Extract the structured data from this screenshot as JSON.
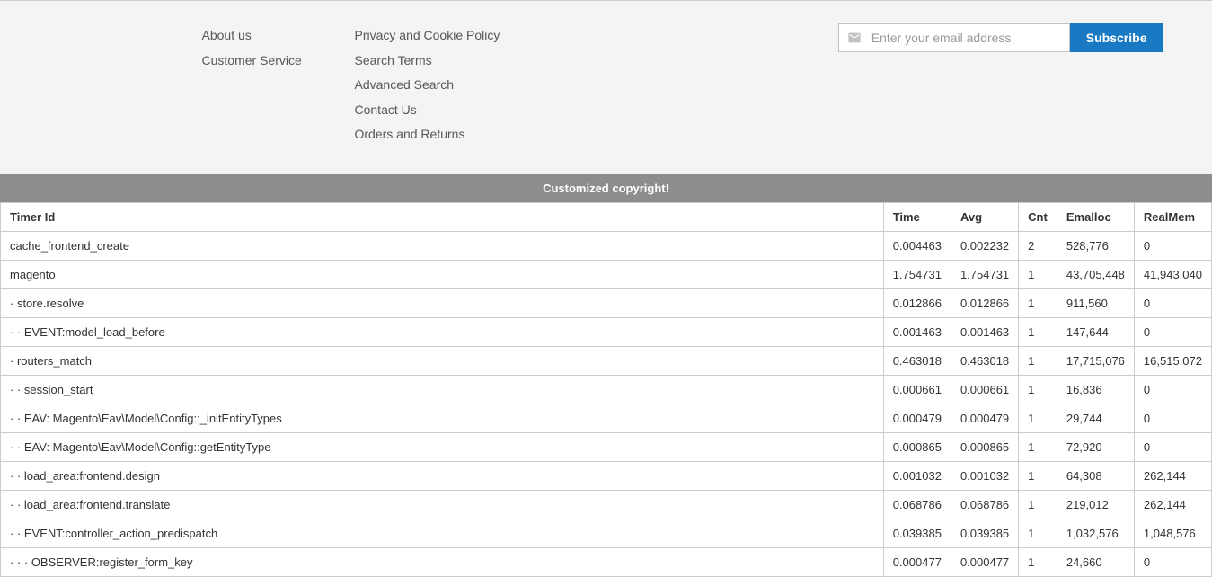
{
  "footer": {
    "col1": [
      {
        "label": "About us"
      },
      {
        "label": "Customer Service"
      }
    ],
    "col2": [
      {
        "label": "Privacy and Cookie Policy"
      },
      {
        "label": "Search Terms"
      },
      {
        "label": "Advanced Search"
      },
      {
        "label": "Contact Us"
      },
      {
        "label": "Orders and Returns"
      }
    ],
    "newsletter": {
      "placeholder": "Enter your email address",
      "subscribe_label": "Subscribe"
    }
  },
  "copyright": "Customized copyright!",
  "profiler": {
    "headers": [
      "Timer Id",
      "Time",
      "Avg",
      "Cnt",
      "Emalloc",
      "RealMem"
    ],
    "rows": [
      {
        "id": "cache_frontend_create",
        "time": "0.004463",
        "avg": "0.002232",
        "cnt": "2",
        "emalloc": "528,776",
        "realmem": "0"
      },
      {
        "id": "magento",
        "time": "1.754731",
        "avg": "1.754731",
        "cnt": "1",
        "emalloc": "43,705,448",
        "realmem": "41,943,040"
      },
      {
        "id": "·  store.resolve",
        "time": "0.012866",
        "avg": "0.012866",
        "cnt": "1",
        "emalloc": "911,560",
        "realmem": "0"
      },
      {
        "id": "·  ·  EVENT:model_load_before",
        "time": "0.001463",
        "avg": "0.001463",
        "cnt": "1",
        "emalloc": "147,644",
        "realmem": "0"
      },
      {
        "id": "·  routers_match",
        "time": "0.463018",
        "avg": "0.463018",
        "cnt": "1",
        "emalloc": "17,715,076",
        "realmem": "16,515,072"
      },
      {
        "id": "·  ·  session_start",
        "time": "0.000661",
        "avg": "0.000661",
        "cnt": "1",
        "emalloc": "16,836",
        "realmem": "0"
      },
      {
        "id": "·  ·  EAV: Magento\\Eav\\Model\\Config::_initEntityTypes",
        "time": "0.000479",
        "avg": "0.000479",
        "cnt": "1",
        "emalloc": "29,744",
        "realmem": "0"
      },
      {
        "id": "·  ·  EAV: Magento\\Eav\\Model\\Config::getEntityType",
        "time": "0.000865",
        "avg": "0.000865",
        "cnt": "1",
        "emalloc": "72,920",
        "realmem": "0"
      },
      {
        "id": "·  ·  load_area:frontend.design",
        "time": "0.001032",
        "avg": "0.001032",
        "cnt": "1",
        "emalloc": "64,308",
        "realmem": "262,144"
      },
      {
        "id": "·  ·  load_area:frontend.translate",
        "time": "0.068786",
        "avg": "0.068786",
        "cnt": "1",
        "emalloc": "219,012",
        "realmem": "262,144"
      },
      {
        "id": "·  ·  EVENT:controller_action_predispatch",
        "time": "0.039385",
        "avg": "0.039385",
        "cnt": "1",
        "emalloc": "1,032,576",
        "realmem": "1,048,576"
      },
      {
        "id": "·  ·  ·  OBSERVER:register_form_key",
        "time": "0.000477",
        "avg": "0.000477",
        "cnt": "1",
        "emalloc": "24,660",
        "realmem": "0"
      }
    ]
  }
}
